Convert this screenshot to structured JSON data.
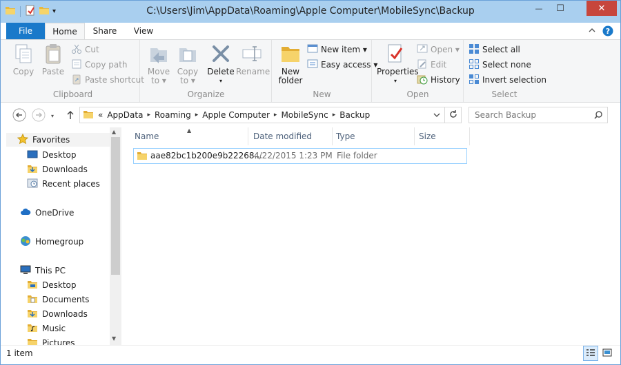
{
  "window": {
    "title": "C:\\Users\\Jim\\AppData\\Roaming\\Apple Computer\\MobileSync\\Backup",
    "close_glyph": "✕",
    "minimize_glyph": "—",
    "maximize_glyph": "☐"
  },
  "qat": {
    "dropdown_glyph": "▾"
  },
  "tabs": {
    "file": "File",
    "home": "Home",
    "share": "Share",
    "view": "View"
  },
  "ribbon": {
    "clipboard": {
      "label": "Clipboard",
      "copy": "Copy",
      "paste": "Paste",
      "cut": "Cut",
      "copy_path": "Copy path",
      "paste_shortcut": "Paste shortcut"
    },
    "organize": {
      "label": "Organize",
      "move_to": "Move",
      "move_to_2": "to ▾",
      "copy_to": "Copy",
      "copy_to_2": "to ▾",
      "delete": "Delete",
      "delete_2": "▾",
      "rename": "Rename"
    },
    "new": {
      "label": "New",
      "new_folder": "New",
      "new_folder_2": "folder",
      "new_item": "New item ▾",
      "easy_access": "Easy access ▾"
    },
    "open": {
      "label": "Open",
      "properties": "Properties",
      "properties_2": "▾",
      "open": "Open ▾",
      "edit": "Edit",
      "history": "History"
    },
    "select": {
      "label": "Select",
      "select_all": "Select all",
      "select_none": "Select none",
      "invert": "Invert selection"
    }
  },
  "address": {
    "prefix": "«",
    "crumbs": [
      "AppData",
      "Roaming",
      "Apple Computer",
      "MobileSync",
      "Backup"
    ],
    "separator": "▸"
  },
  "search": {
    "placeholder": "Search Backup"
  },
  "navpane": {
    "favorites": "Favorites",
    "desktop": "Desktop",
    "downloads": "Downloads",
    "recent": "Recent places",
    "onedrive": "OneDrive",
    "homegroup": "Homegroup",
    "thispc": "This PC",
    "pc_desktop": "Desktop",
    "pc_documents": "Documents",
    "pc_downloads": "Downloads",
    "pc_music": "Music",
    "pc_pictures": "Pictures"
  },
  "columns": {
    "name": "Name",
    "date": "Date modified",
    "type": "Type",
    "size": "Size"
  },
  "files": [
    {
      "name": "aae82bc1b200e9b22268...",
      "date": "4/22/2015 1:23 PM",
      "type": "File folder",
      "size": ""
    }
  ],
  "status": {
    "count": "1 item"
  },
  "colors": {
    "titlebar": "#a9cfef",
    "file_tab": "#1979ca",
    "close": "#c7463c",
    "selection_border": "#99d1ff",
    "folder": "#f3c54f"
  }
}
